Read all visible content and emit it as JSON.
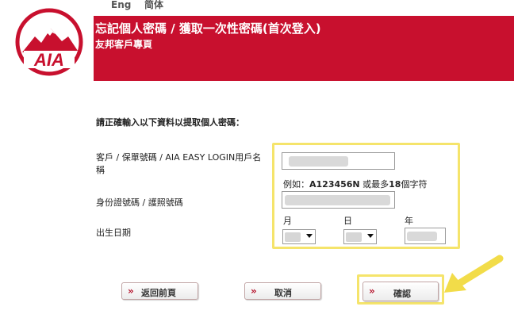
{
  "header": {
    "lang_english": "Eng",
    "lang_simplified": "简体",
    "logo_text": "AIA",
    "title": "忘記個人密碼 / 獲取一次性密碼(首次登入)",
    "subtitle": "友邦客戶專頁"
  },
  "form": {
    "instruction": "請正確輸入以下資料以提取個人密碼：",
    "policy_label_line1": "客戶 / 保單號碼 / AIA EASY LOGIN用戶名",
    "policy_label_line2": "稱",
    "policy_hint_prefix": "例如：",
    "policy_hint_example": "A123456N",
    "policy_hint_mid": " 或最多",
    "policy_hint_number": "18",
    "policy_hint_suffix": "個字符",
    "id_label": "身份證號碼 / 護照號碼",
    "dob_label": "出生日期",
    "month_label": "月",
    "day_label": "日",
    "year_label": "年"
  },
  "buttons": {
    "chevron": "»",
    "back": "返回前頁",
    "cancel": "取消",
    "confirm": "確認"
  },
  "colors": {
    "brand_red": "#c8102e",
    "highlight_yellow": "#f5e46b"
  }
}
